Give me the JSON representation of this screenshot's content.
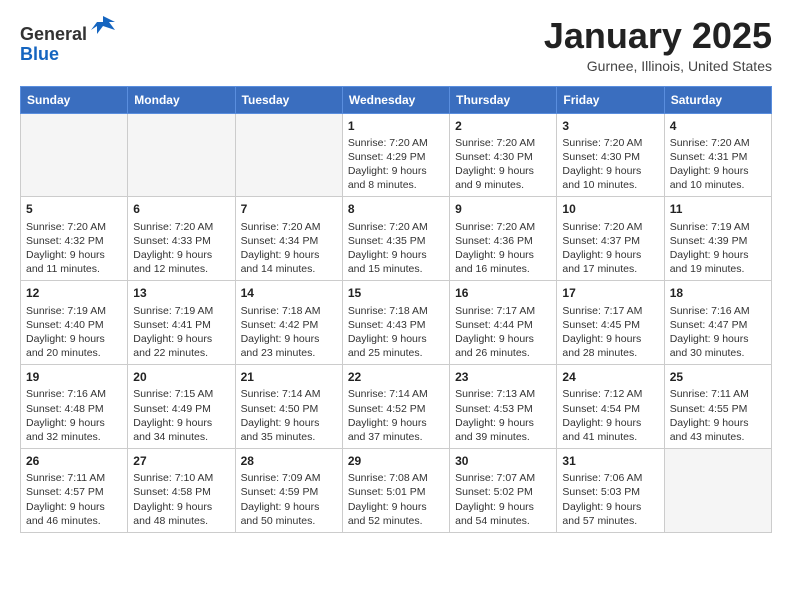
{
  "header": {
    "logo": {
      "line1": "General",
      "line2": "Blue"
    },
    "title": "January 2025",
    "location": "Gurnee, Illinois, United States"
  },
  "days_of_week": [
    "Sunday",
    "Monday",
    "Tuesday",
    "Wednesday",
    "Thursday",
    "Friday",
    "Saturday"
  ],
  "weeks": [
    [
      {
        "day": "",
        "info": ""
      },
      {
        "day": "",
        "info": ""
      },
      {
        "day": "",
        "info": ""
      },
      {
        "day": "1",
        "info": "Sunrise: 7:20 AM\nSunset: 4:29 PM\nDaylight: 9 hours and 8 minutes."
      },
      {
        "day": "2",
        "info": "Sunrise: 7:20 AM\nSunset: 4:30 PM\nDaylight: 9 hours and 9 minutes."
      },
      {
        "day": "3",
        "info": "Sunrise: 7:20 AM\nSunset: 4:30 PM\nDaylight: 9 hours and 10 minutes."
      },
      {
        "day": "4",
        "info": "Sunrise: 7:20 AM\nSunset: 4:31 PM\nDaylight: 9 hours and 10 minutes."
      }
    ],
    [
      {
        "day": "5",
        "info": "Sunrise: 7:20 AM\nSunset: 4:32 PM\nDaylight: 9 hours and 11 minutes."
      },
      {
        "day": "6",
        "info": "Sunrise: 7:20 AM\nSunset: 4:33 PM\nDaylight: 9 hours and 12 minutes."
      },
      {
        "day": "7",
        "info": "Sunrise: 7:20 AM\nSunset: 4:34 PM\nDaylight: 9 hours and 14 minutes."
      },
      {
        "day": "8",
        "info": "Sunrise: 7:20 AM\nSunset: 4:35 PM\nDaylight: 9 hours and 15 minutes."
      },
      {
        "day": "9",
        "info": "Sunrise: 7:20 AM\nSunset: 4:36 PM\nDaylight: 9 hours and 16 minutes."
      },
      {
        "day": "10",
        "info": "Sunrise: 7:20 AM\nSunset: 4:37 PM\nDaylight: 9 hours and 17 minutes."
      },
      {
        "day": "11",
        "info": "Sunrise: 7:19 AM\nSunset: 4:39 PM\nDaylight: 9 hours and 19 minutes."
      }
    ],
    [
      {
        "day": "12",
        "info": "Sunrise: 7:19 AM\nSunset: 4:40 PM\nDaylight: 9 hours and 20 minutes."
      },
      {
        "day": "13",
        "info": "Sunrise: 7:19 AM\nSunset: 4:41 PM\nDaylight: 9 hours and 22 minutes."
      },
      {
        "day": "14",
        "info": "Sunrise: 7:18 AM\nSunset: 4:42 PM\nDaylight: 9 hours and 23 minutes."
      },
      {
        "day": "15",
        "info": "Sunrise: 7:18 AM\nSunset: 4:43 PM\nDaylight: 9 hours and 25 minutes."
      },
      {
        "day": "16",
        "info": "Sunrise: 7:17 AM\nSunset: 4:44 PM\nDaylight: 9 hours and 26 minutes."
      },
      {
        "day": "17",
        "info": "Sunrise: 7:17 AM\nSunset: 4:45 PM\nDaylight: 9 hours and 28 minutes."
      },
      {
        "day": "18",
        "info": "Sunrise: 7:16 AM\nSunset: 4:47 PM\nDaylight: 9 hours and 30 minutes."
      }
    ],
    [
      {
        "day": "19",
        "info": "Sunrise: 7:16 AM\nSunset: 4:48 PM\nDaylight: 9 hours and 32 minutes."
      },
      {
        "day": "20",
        "info": "Sunrise: 7:15 AM\nSunset: 4:49 PM\nDaylight: 9 hours and 34 minutes."
      },
      {
        "day": "21",
        "info": "Sunrise: 7:14 AM\nSunset: 4:50 PM\nDaylight: 9 hours and 35 minutes."
      },
      {
        "day": "22",
        "info": "Sunrise: 7:14 AM\nSunset: 4:52 PM\nDaylight: 9 hours and 37 minutes."
      },
      {
        "day": "23",
        "info": "Sunrise: 7:13 AM\nSunset: 4:53 PM\nDaylight: 9 hours and 39 minutes."
      },
      {
        "day": "24",
        "info": "Sunrise: 7:12 AM\nSunset: 4:54 PM\nDaylight: 9 hours and 41 minutes."
      },
      {
        "day": "25",
        "info": "Sunrise: 7:11 AM\nSunset: 4:55 PM\nDaylight: 9 hours and 43 minutes."
      }
    ],
    [
      {
        "day": "26",
        "info": "Sunrise: 7:11 AM\nSunset: 4:57 PM\nDaylight: 9 hours and 46 minutes."
      },
      {
        "day": "27",
        "info": "Sunrise: 7:10 AM\nSunset: 4:58 PM\nDaylight: 9 hours and 48 minutes."
      },
      {
        "day": "28",
        "info": "Sunrise: 7:09 AM\nSunset: 4:59 PM\nDaylight: 9 hours and 50 minutes."
      },
      {
        "day": "29",
        "info": "Sunrise: 7:08 AM\nSunset: 5:01 PM\nDaylight: 9 hours and 52 minutes."
      },
      {
        "day": "30",
        "info": "Sunrise: 7:07 AM\nSunset: 5:02 PM\nDaylight: 9 hours and 54 minutes."
      },
      {
        "day": "31",
        "info": "Sunrise: 7:06 AM\nSunset: 5:03 PM\nDaylight: 9 hours and 57 minutes."
      },
      {
        "day": "",
        "info": ""
      }
    ]
  ]
}
